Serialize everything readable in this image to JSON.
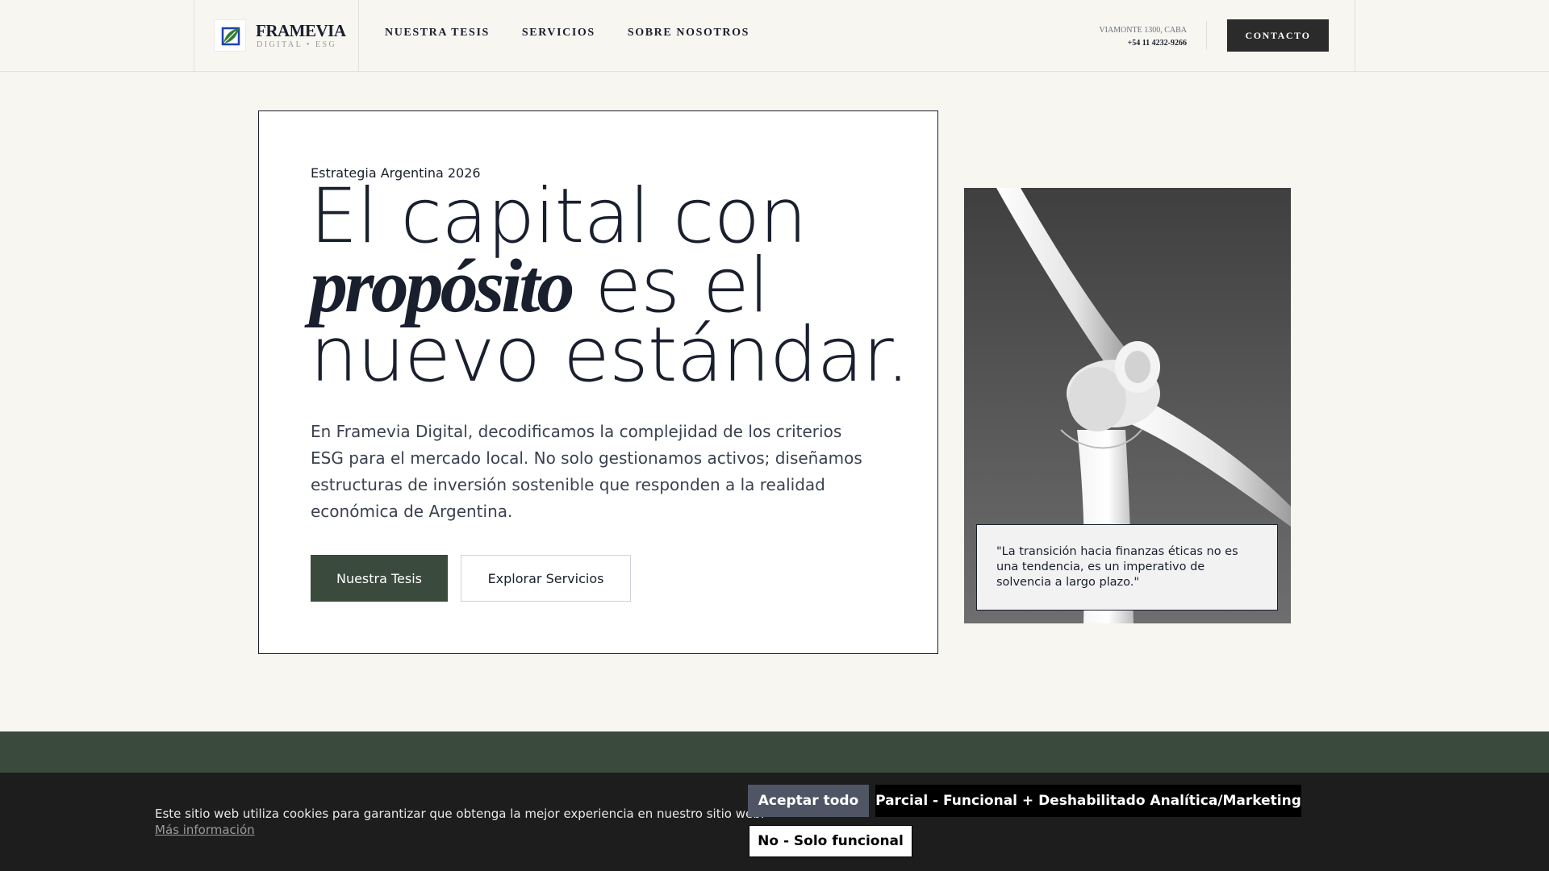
{
  "header": {
    "brand_name": "FRAMEVIA",
    "brand_sub": "DIGITAL • ESG",
    "nav": [
      "NUESTRA TESIS",
      "SERVICIOS",
      "SOBRE NOSOTROS"
    ],
    "address": "VIAMONTE 1300, CABA",
    "phone": "+54 11 4232-9266",
    "contact_label": "CONTACTO"
  },
  "hero": {
    "eyebrow": "Estrategia Argentina 2026",
    "headline_line1": "El capital con",
    "headline_italic": "propósito",
    "headline_line2_rest": " es el",
    "headline_line3": "nuevo estándar.",
    "lead": "En Framevia Digital, decodificamos la complejidad de los criterios ESG para el mercado local. No solo gestionamos activos; diseñamos estructuras de inversión sostenible que responden a la realidad económica de Argentina.",
    "primary_button": "Nuestra Tesis",
    "secondary_button": "Explorar Servicios"
  },
  "image_panel": {
    "quote": "\"La transición hacia finanzas éticas no es una tendencia, es un imperativo de solvencia a largo plazo.\""
  },
  "cookie_banner": {
    "text": "Este sitio web utiliza cookies para garantizar que obtenga la mejor experiencia en nuestro sitio web.",
    "more_link": "Más información",
    "accept_all": "Aceptar todo",
    "partial": "Parcial - Funcional + Deshabilitado Analítica/Marketing",
    "functional_only": "No - Solo funcional"
  },
  "colors": {
    "background": "#f7f6f1",
    "accent_green": "#3a4a3c",
    "text_dark": "#1a1f2e",
    "cookie_bg": "#1d1d1d"
  }
}
